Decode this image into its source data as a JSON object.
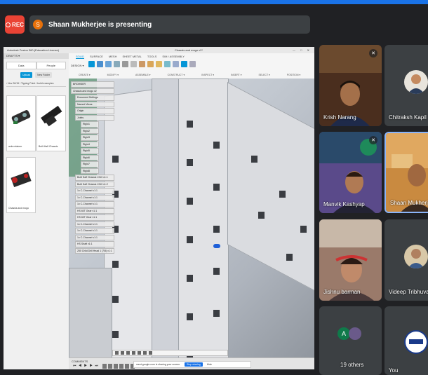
{
  "meet": {
    "rec_label": "REC",
    "presenter_initial": "S",
    "presenter_text": "Shaan Mukherjee is presenting"
  },
  "participants": [
    {
      "name": "Krish Narang",
      "muted": true
    },
    {
      "name": "Chitraksh Kapil",
      "muted": false
    },
    {
      "name": "Manvik Kashyap",
      "muted": true
    },
    {
      "name": "Shaan Mukherjee",
      "muted": false,
      "active": true
    },
    {
      "name": "Jishnu barman",
      "muted": false
    },
    {
      "name": "Videep Tribhuvan",
      "muted": false
    },
    {
      "name": "19 others",
      "initial": "A"
    },
    {
      "name": "You"
    }
  ],
  "fusion": {
    "app_title": "Autodesk Fusion 360 (Education License)",
    "doc_title": "Chassis and mogo v2*",
    "window_controls": "— □ ✕",
    "design_label": "DESIGN ▾",
    "tabs": [
      "SOLID",
      "SURFACE",
      "MESH",
      "SHEET METAL",
      "TOOLS",
      "SIM / ASSEMBLY"
    ],
    "groups": [
      "CREATE ▾",
      "MODIFY ▾",
      "ASSEMBLE ▾",
      "CONSTRUCT ▾",
      "INSPECT ▾",
      "INSERT ▾",
      "SELECT ▾",
      "POSITION ▾"
    ],
    "data_panel": {
      "header": "DRAFTS ▾",
      "tabs": [
        "Data",
        "People"
      ],
      "buttons": [
        "Upload",
        "New Folder"
      ],
      "path": "‹ Nov 26/15 / Tipping Point / build examples",
      "items": [
        {
          "label": "axle retainer"
        },
        {
          "label": "Built Half Chassis"
        },
        {
          "label": "Chassis and mogo"
        }
      ]
    },
    "browser": {
      "items": [
        {
          "label": "BROWSER",
          "level": 0
        },
        {
          "label": "Chassis and mogo v2",
          "level": 0
        },
        {
          "label": "Document Settings",
          "level": 1
        },
        {
          "label": "Named Views",
          "level": 1
        },
        {
          "label": "Origin",
          "level": 1
        },
        {
          "label": "Joints",
          "level": 1
        },
        {
          "label": "Rigid1",
          "level": 2
        },
        {
          "label": "Rigid2",
          "level": 2
        },
        {
          "label": "Rigid3",
          "level": 2
        },
        {
          "label": "Rigid4",
          "level": 2
        },
        {
          "label": "Rigid5",
          "level": 2
        },
        {
          "label": "Rigid6",
          "level": 2
        },
        {
          "label": "Rigid7",
          "level": 2
        },
        {
          "label": "Rigid8",
          "level": 2
        },
        {
          "label": "Built Half Chassis 1910 v1:1",
          "level": 1
        },
        {
          "label": "Built Half Chassis 1910 v1:2",
          "level": 1
        },
        {
          "label": "1x C-Channel v1:1",
          "level": 1
        },
        {
          "label": "1x C-Channel v1:1",
          "level": 1
        },
        {
          "label": "1x C-Channel v1:1",
          "level": 1
        },
        {
          "label": "HS 60T Gear v1:1",
          "level": 1
        },
        {
          "label": "HS 60T Gear v1:1",
          "level": 1
        },
        {
          "label": "1x C-Channel v1:1",
          "level": 1
        },
        {
          "label": "1x C-Channel v1:1",
          "level": 1
        },
        {
          "label": "1x C-Channel v1:1",
          "level": 1
        },
        {
          "label": "HS Shaft v1:1",
          "level": 1
        },
        {
          "label": "250 Child Drill Head 1 (7/8) v1:1",
          "level": 1
        }
      ]
    },
    "comments_label": "COMMENTS",
    "timeline_controls": "⏮ ◀ ▶ ▶ ⏭",
    "share_bar": {
      "message": "meet.google.com is sharing your screen.",
      "stop_label": "Stop sharing",
      "hide_label": "Hide"
    }
  },
  "colors": {
    "accent": "#1a73e8",
    "rec_red": "#ea4335",
    "fusion_blue": "#0696d7",
    "meet_bg": "#202124",
    "tile_bg": "#3c4043"
  }
}
